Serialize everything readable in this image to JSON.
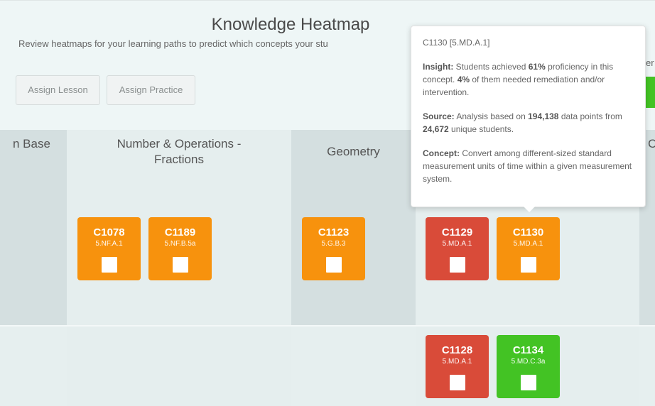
{
  "header": {
    "title": "Knowledge Heatmap",
    "subtitle": "Review heatmaps for your learning paths to predict which concepts your stu",
    "assign_lesson_label": "Assign Lesson",
    "assign_practice_label": "Assign Practice",
    "cut_text": "er"
  },
  "columns": [
    {
      "label": "n Base"
    },
    {
      "label": "Number & Operations - Fractions"
    },
    {
      "label": "Geometry"
    },
    {
      "label": ""
    },
    {
      "label": "C"
    }
  ],
  "tiles": [
    {
      "code": "C1078",
      "standard": "5.NF.A.1",
      "status": "orange"
    },
    {
      "code": "C1189",
      "standard": "5.NF.B.5a",
      "status": "orange"
    },
    {
      "code": "C1123",
      "standard": "5.G.B.3",
      "status": "orange"
    },
    {
      "code": "C1129",
      "standard": "5.MD.A.1",
      "status": "red"
    },
    {
      "code": "C1130",
      "standard": "5.MD.A.1",
      "status": "orange"
    },
    {
      "code": "C1128",
      "standard": "5.MD.A.1",
      "status": "red"
    },
    {
      "code": "C1134",
      "standard": "5.MD.C.3a",
      "status": "green"
    }
  ],
  "tooltip": {
    "title": "C1130 [5.MD.A.1]",
    "insight_label": "Insight:",
    "insight_1": " Students achieved ",
    "insight_pct": "61%",
    "insight_2": " proficiency in this concept. ",
    "insight_pct2": "4%",
    "insight_3": " of them needed remediation and/or intervention.",
    "source_label": "Source:",
    "source_1": " Analysis based on ",
    "source_points": "194,138",
    "source_2": " data points from ",
    "source_students": "24,672",
    "source_3": " unique students.",
    "concept_label": "Concept:",
    "concept_text": " Convert among different-sized standard measurement units of time within a given measurement system."
  },
  "colors": {
    "orange": "#f7920d",
    "red": "#d94b39",
    "green": "#43c324",
    "col_dark": "#d4dfe0",
    "col_light": "#e5eeee"
  }
}
